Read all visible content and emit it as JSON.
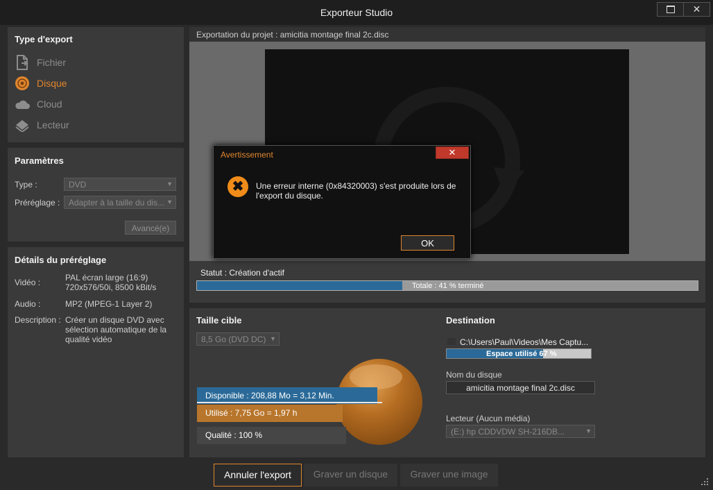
{
  "window": {
    "title": "Exporteur Studio",
    "minimize_icon": "maximize-icon",
    "close_glyph": "✕"
  },
  "export_type": {
    "title": "Type d'export",
    "items": [
      {
        "label": "Fichier",
        "icon": "file-icon",
        "active": false
      },
      {
        "label": "Disque",
        "icon": "disc-icon",
        "active": true
      },
      {
        "label": "Cloud",
        "icon": "cloud-icon",
        "active": false
      },
      {
        "label": "Lecteur",
        "icon": "drive-icon",
        "active": false
      }
    ]
  },
  "params": {
    "title": "Paramètres",
    "type_label": "Type :",
    "type_value": "DVD",
    "preset_label": "Préréglage :",
    "preset_value": "Adapter à la taille du dis...",
    "advanced_button": "Avancé(e)"
  },
  "preset_details": {
    "title": "Détails du préréglage",
    "video_label": "Vidéo :",
    "video_value": "PAL écran large (16:9)\n720x576/50i, 8500 kBit/s",
    "audio_label": "Audio :",
    "audio_value": "MP2 (MPEG-1 Layer 2)",
    "description_label": "Description :",
    "description_value": "Créer un disque DVD avec sélection automatique de la qualité vidéo"
  },
  "preview": {
    "header": "Exportation du projet : amicitia montage final 2c.disc"
  },
  "status": {
    "label": "Statut : Création d'actif",
    "progress_text": "Totale : 41 % terminé",
    "progress_percent": 41
  },
  "target": {
    "title": "Taille cible",
    "size_select": "8,5 Go (DVD DC)",
    "available": "Disponible : 208,88 Mo = 3,12 Min.",
    "used": "Utilisé : 7,75 Go = 1,97 h",
    "quality": "Qualité :  100 %"
  },
  "destination": {
    "title": "Destination",
    "path": "C:\\Users\\Paul\\Videos\\Mes Captu...",
    "space_text": "Espace utilisé 67 %",
    "space_percent": 67,
    "disc_name_label": "Nom du disque",
    "disc_name_value": "amicitia montage final 2c.disc",
    "drive_label": "Lecteur  (Aucun média)",
    "drive_value": "(E:) hp      CDDVDW SH-216DB..."
  },
  "dialog": {
    "title": "Avertissement",
    "close_glyph": "✕",
    "message": "Une erreur interne (0x84320003) s'est produite lors de l'export du disque.",
    "icon_glyph": "✖",
    "ok_button": "OK"
  },
  "footer": {
    "cancel_button": "Annuler l'export",
    "burn_button": "Graver un disque",
    "image_button": "Graver une image"
  },
  "colors": {
    "accent": "#e0862e",
    "progress_blue": "#2b6a98",
    "error_red": "#c0392b"
  }
}
